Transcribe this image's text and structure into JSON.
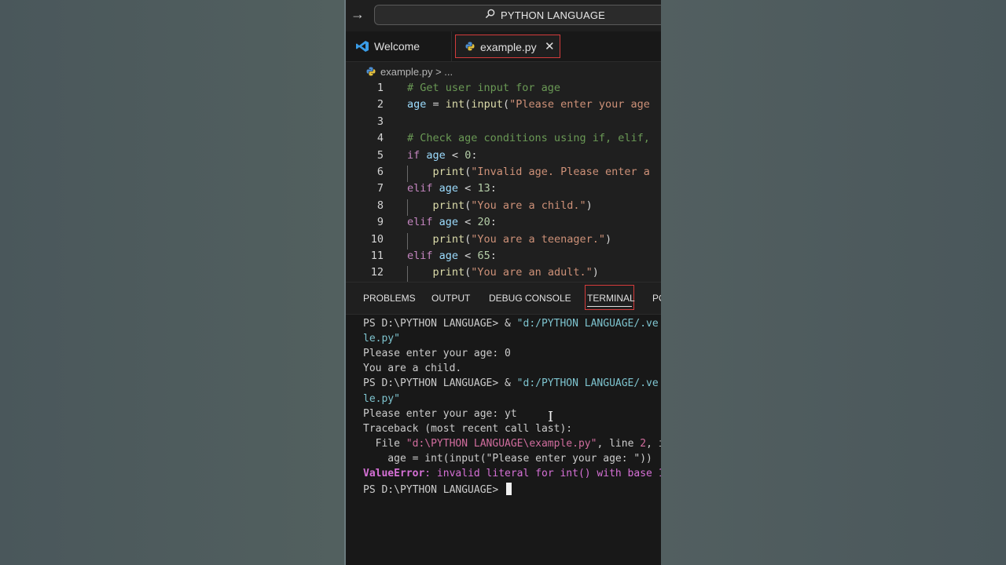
{
  "titlebar": {
    "search_text": "PYTHON LANGUAGE"
  },
  "tabs": [
    {
      "label": "Welcome",
      "active": false
    },
    {
      "label": "example.py",
      "active": true
    }
  ],
  "breadcrumb": {
    "text": "example.py > ..."
  },
  "editor": {
    "lines": [
      {
        "n": "1",
        "tokens": [
          [
            "c-com",
            "# Get user input for age"
          ]
        ]
      },
      {
        "n": "2",
        "tokens": [
          [
            "c-var",
            "age"
          ],
          [
            "c-op",
            " = "
          ],
          [
            "c-fn",
            "int"
          ],
          [
            "c-op",
            "("
          ],
          [
            "c-fn",
            "input"
          ],
          [
            "c-op",
            "("
          ],
          [
            "c-str",
            "\"Please enter your age"
          ]
        ]
      },
      {
        "n": "3",
        "tokens": []
      },
      {
        "n": "4",
        "tokens": [
          [
            "c-com",
            "# Check age conditions using if, elif,"
          ]
        ]
      },
      {
        "n": "5",
        "tokens": [
          [
            "c-kw",
            "if"
          ],
          [
            "c-op",
            " "
          ],
          [
            "c-var",
            "age"
          ],
          [
            "c-op",
            " < "
          ],
          [
            "c-num",
            "0"
          ],
          [
            "c-op",
            ":"
          ]
        ]
      },
      {
        "n": "6",
        "guide": true,
        "tokens": [
          [
            "c-op",
            "    "
          ],
          [
            "c-fn",
            "print"
          ],
          [
            "c-op",
            "("
          ],
          [
            "c-str",
            "\"Invalid age. Please enter a"
          ]
        ]
      },
      {
        "n": "7",
        "tokens": [
          [
            "c-kw",
            "elif"
          ],
          [
            "c-op",
            " "
          ],
          [
            "c-var",
            "age"
          ],
          [
            "c-op",
            " < "
          ],
          [
            "c-num",
            "13"
          ],
          [
            "c-op",
            ":"
          ]
        ]
      },
      {
        "n": "8",
        "guide": true,
        "tokens": [
          [
            "c-op",
            "    "
          ],
          [
            "c-fn",
            "print"
          ],
          [
            "c-op",
            "("
          ],
          [
            "c-str",
            "\"You are a child.\""
          ],
          [
            "c-op",
            ")"
          ]
        ]
      },
      {
        "n": "9",
        "tokens": [
          [
            "c-kw",
            "elif"
          ],
          [
            "c-op",
            " "
          ],
          [
            "c-var",
            "age"
          ],
          [
            "c-op",
            " < "
          ],
          [
            "c-num",
            "20"
          ],
          [
            "c-op",
            ":"
          ]
        ]
      },
      {
        "n": "10",
        "guide": true,
        "tokens": [
          [
            "c-op",
            "    "
          ],
          [
            "c-fn",
            "print"
          ],
          [
            "c-op",
            "("
          ],
          [
            "c-str",
            "\"You are a teenager.\""
          ],
          [
            "c-op",
            ")"
          ]
        ]
      },
      {
        "n": "11",
        "tokens": [
          [
            "c-kw",
            "elif"
          ],
          [
            "c-op",
            " "
          ],
          [
            "c-var",
            "age"
          ],
          [
            "c-op",
            " < "
          ],
          [
            "c-num",
            "65"
          ],
          [
            "c-op",
            ":"
          ]
        ]
      },
      {
        "n": "12",
        "guide": true,
        "tokens": [
          [
            "c-op",
            "    "
          ],
          [
            "c-fn",
            "print"
          ],
          [
            "c-op",
            "("
          ],
          [
            "c-str",
            "\"You are an adult.\""
          ],
          [
            "c-op",
            ")"
          ]
        ]
      }
    ]
  },
  "panel_tabs": [
    {
      "label": "PROBLEMS"
    },
    {
      "label": "OUTPUT"
    },
    {
      "label": "DEBUG CONSOLE"
    },
    {
      "label": "TERMINAL",
      "active": true
    },
    {
      "label": "PO"
    }
  ],
  "terminal": {
    "lines": [
      [
        [
          "",
          "PS D:\\PYTHON LANGUAGE> & "
        ],
        [
          "t-str",
          "\"d:/PYTHON LANGUAGE/.ve"
        ]
      ],
      [
        [
          "t-str",
          "le.py\""
        ]
      ],
      [
        [
          "",
          "Please enter your age: 0"
        ]
      ],
      [
        [
          "",
          "You are a child."
        ]
      ],
      [
        [
          "",
          "PS D:\\PYTHON LANGUAGE> & "
        ],
        [
          "t-str",
          "\"d:/PYTHON LANGUAGE/.ve"
        ]
      ],
      [
        [
          "t-str",
          "le.py\""
        ]
      ],
      [
        [
          "",
          "Please enter your age: yt"
        ]
      ],
      [
        [
          "",
          "Traceback (most recent call last):"
        ]
      ],
      [
        [
          "",
          "  File "
        ],
        [
          "t-path",
          "\"d:\\PYTHON LANGUAGE\\example.py\""
        ],
        [
          "",
          ", line "
        ],
        [
          "t-path",
          "2"
        ],
        [
          "",
          ", i"
        ]
      ],
      [
        [
          "",
          "    age = int(input(\"Please enter your age: \"))"
        ]
      ],
      [
        [
          "t-errb",
          "ValueError"
        ],
        [
          "t-err",
          ": invalid literal for int() with base 1"
        ]
      ],
      [
        [
          "",
          "PS D:\\PYTHON LANGUAGE> "
        ]
      ]
    ]
  }
}
